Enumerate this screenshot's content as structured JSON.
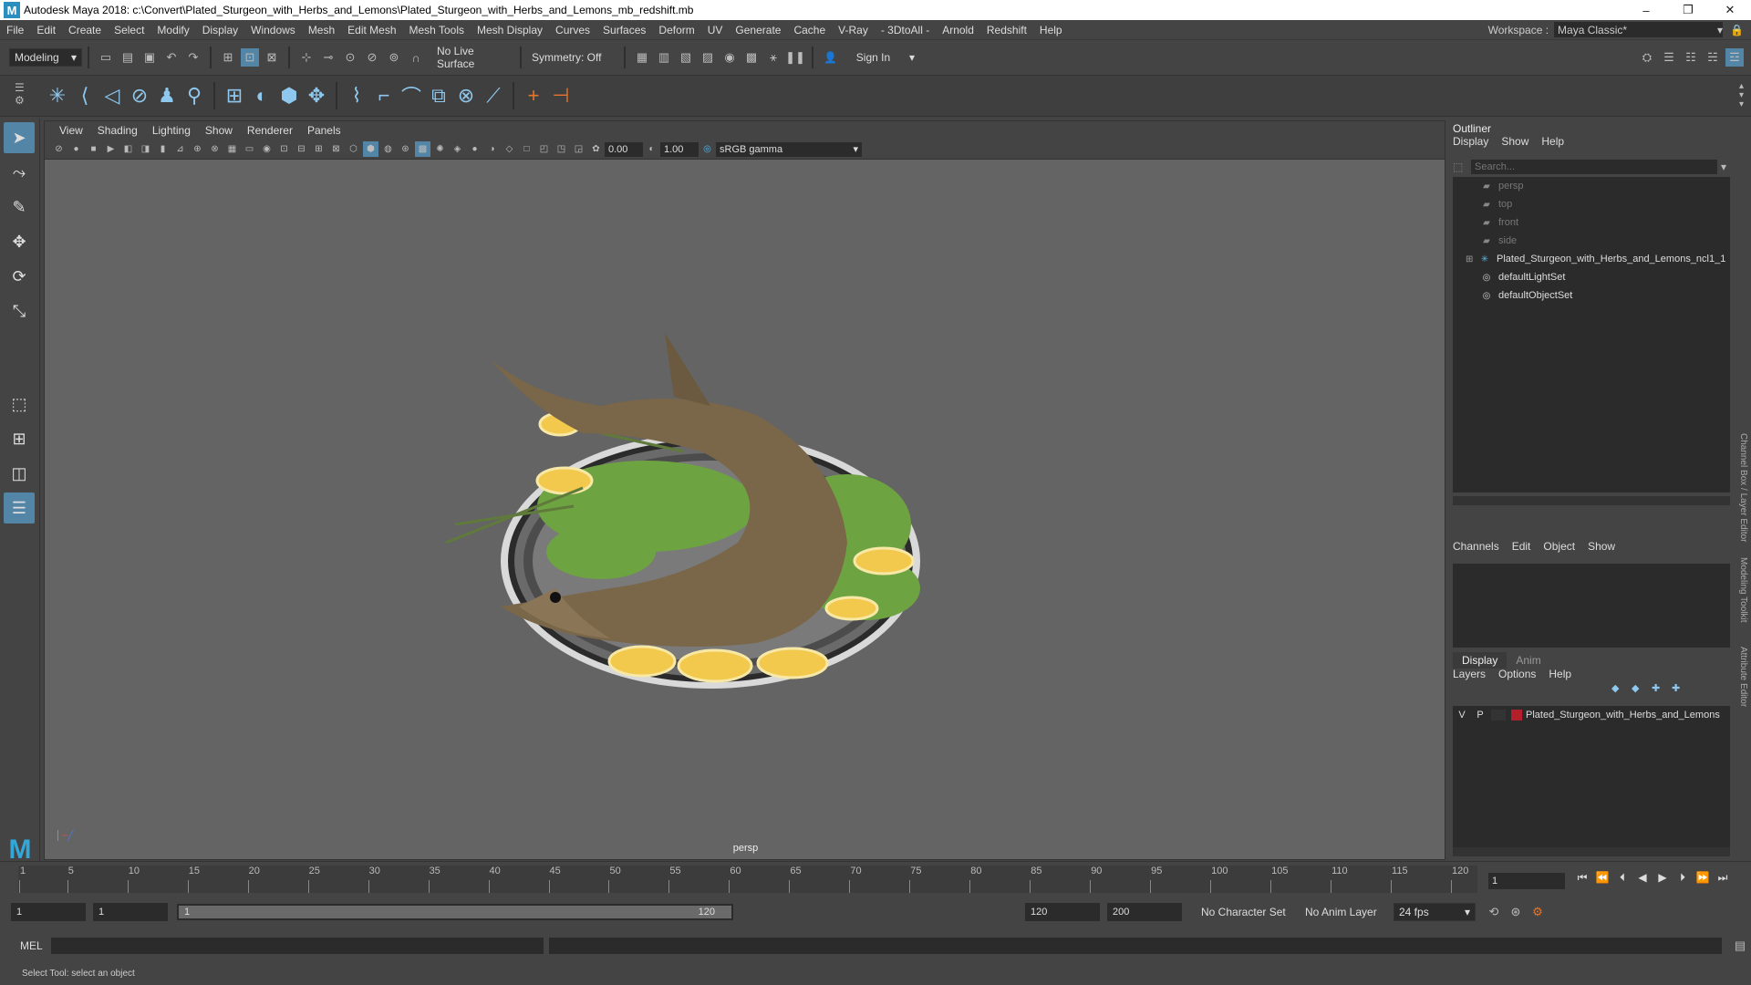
{
  "window": {
    "logo": "M",
    "title": "Autodesk Maya 2018: c:\\Convert\\Plated_Sturgeon_with_Herbs_and_Lemons\\Plated_Sturgeon_with_Herbs_and_Lemons_mb_redshift.mb",
    "minimize": "–",
    "maximize": "❐",
    "close": "✕"
  },
  "menubar": {
    "items": [
      "File",
      "Edit",
      "Create",
      "Select",
      "Modify",
      "Display",
      "Windows",
      "Mesh",
      "Edit Mesh",
      "Mesh Tools",
      "Mesh Display",
      "Curves",
      "Surfaces",
      "Deform",
      "UV",
      "Generate",
      "Cache",
      "V-Ray",
      "- 3DtoAll -",
      "Arnold",
      "Redshift",
      "Help"
    ],
    "workspace_label": "Workspace :",
    "workspace_value": "Maya Classic*"
  },
  "statusline": {
    "mode": "Modeling",
    "live_surface": "No Live Surface",
    "symmetry": "Symmetry: Off",
    "sign_in": "Sign In"
  },
  "viewport": {
    "menu": [
      "View",
      "Shading",
      "Lighting",
      "Show",
      "Renderer",
      "Panels"
    ],
    "exposure": "0.00",
    "gamma": "1.00",
    "color_space": "sRGB gamma",
    "camera": "persp"
  },
  "outliner": {
    "title": "Outliner",
    "menu": [
      "Display",
      "Show",
      "Help"
    ],
    "search_placeholder": "Search...",
    "items": [
      {
        "label": "persp",
        "dim": true,
        "icon": "camera-icon"
      },
      {
        "label": "top",
        "dim": true,
        "icon": "camera-icon"
      },
      {
        "label": "front",
        "dim": true,
        "icon": "camera-icon"
      },
      {
        "label": "side",
        "dim": true,
        "icon": "camera-icon"
      },
      {
        "label": "Plated_Sturgeon_with_Herbs_and_Lemons_ncl1_1",
        "dim": false,
        "icon": "group-icon"
      },
      {
        "label": "defaultLightSet",
        "dim": false,
        "icon": "set-icon"
      },
      {
        "label": "defaultObjectSet",
        "dim": false,
        "icon": "set-icon"
      }
    ]
  },
  "channelbox": {
    "menu": [
      "Channels",
      "Edit",
      "Object",
      "Show"
    ],
    "tab_label": "Channel Box / Layer Editor"
  },
  "layers": {
    "tabs": [
      "Display",
      "Anim"
    ],
    "menu": [
      "Layers",
      "Options",
      "Help"
    ],
    "row": {
      "v": "V",
      "p": "P",
      "name": "Plated_Sturgeon_with_Herbs_and_Lemons",
      "color": "#b3202b"
    }
  },
  "side_tabs": [
    "Modeling Toolkit",
    "Attribute Editor"
  ],
  "timeline": {
    "ticks": [
      "1",
      "5",
      "10",
      "15",
      "20",
      "25",
      "30",
      "35",
      "40",
      "45",
      "50",
      "55",
      "60",
      "65",
      "70",
      "75",
      "80",
      "85",
      "90",
      "95",
      "100",
      "105",
      "110",
      "115",
      "120"
    ],
    "current_frame": "1"
  },
  "range": {
    "start": "1",
    "playback_start": "1",
    "slider_start": "1",
    "slider_end": "120",
    "playback_end": "120",
    "end": "200",
    "character_set": "No Character Set",
    "anim_layer": "No Anim Layer",
    "fps": "24 fps"
  },
  "cmdline": {
    "label": "MEL"
  },
  "helpline": {
    "text": "Select Tool: select an object"
  }
}
